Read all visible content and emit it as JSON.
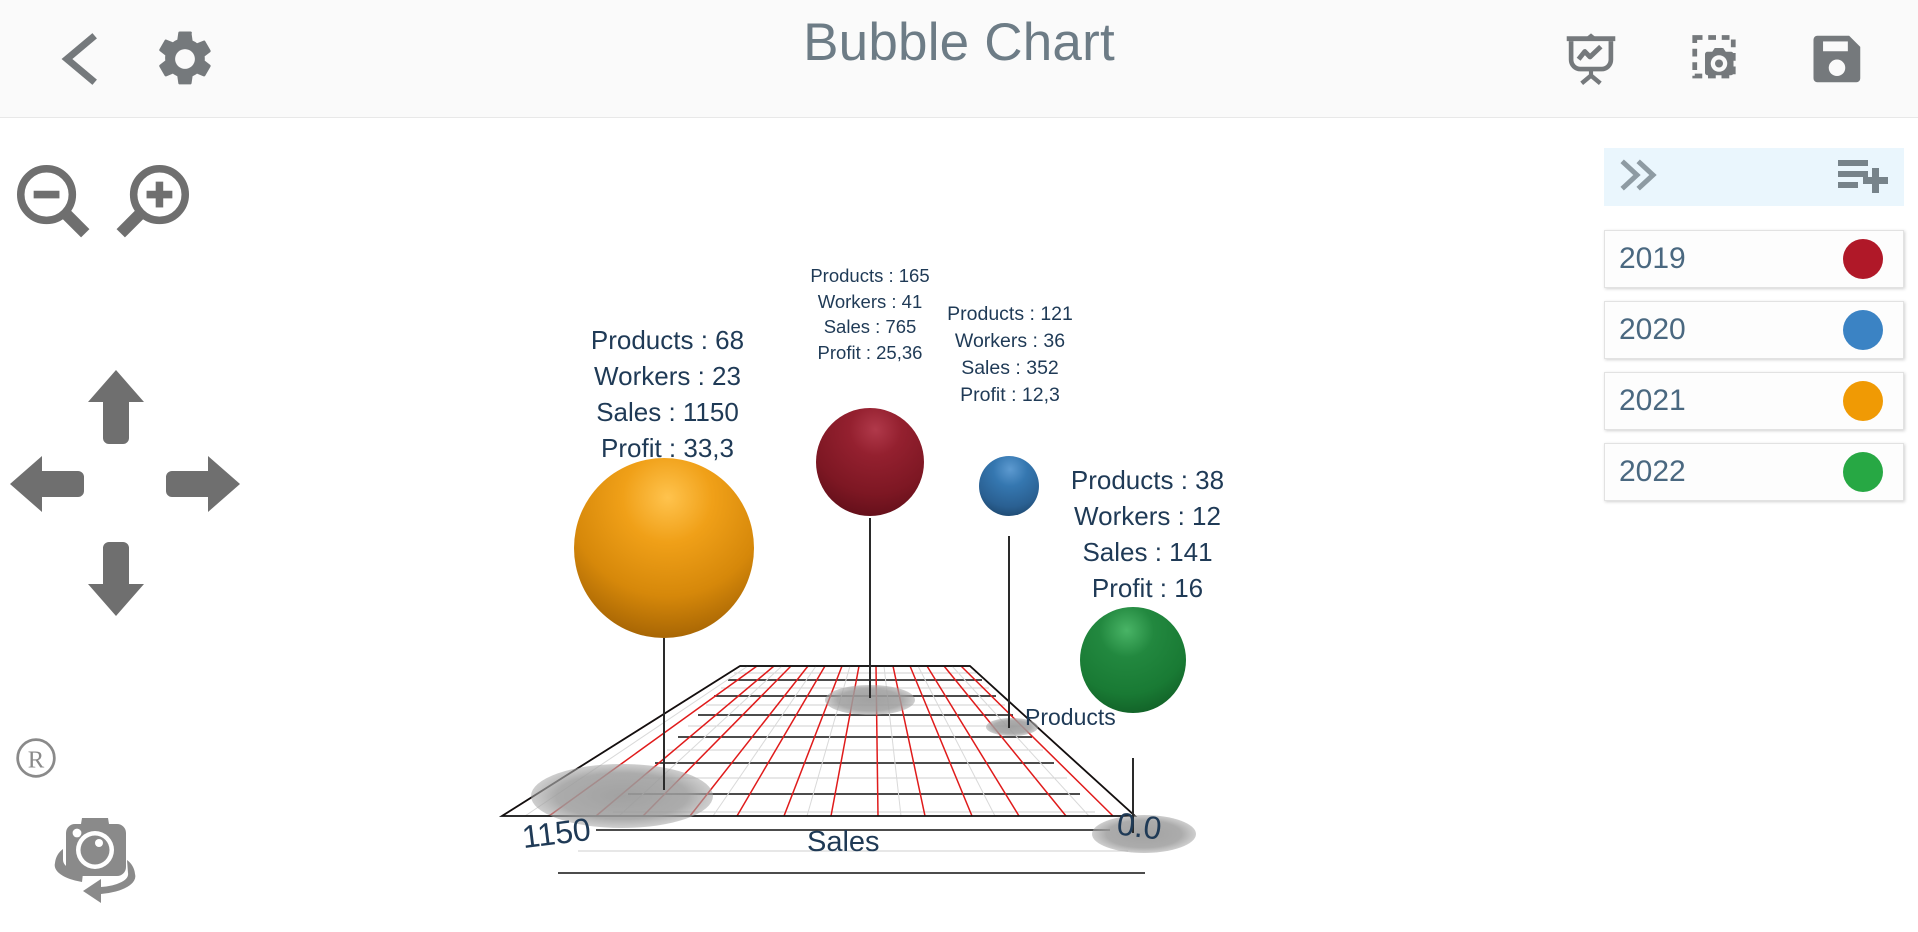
{
  "header": {
    "title": "Bubble Chart",
    "back_icon": "chevron-left-icon",
    "settings_icon": "gear-icon",
    "presentation_icon": "presentation-chart-icon",
    "snapshot_icon": "screenshot-camera-icon",
    "save_icon": "floppy-save-icon"
  },
  "left_rail": {
    "zoom_out_icon": "magnifier-minus-icon",
    "zoom_in_icon": "magnifier-plus-icon",
    "pan_up_icon": "arrow-up-icon",
    "pan_down_icon": "arrow-down-icon",
    "pan_left_icon": "arrow-left-icon",
    "pan_right_icon": "arrow-right-icon",
    "reset_icon": "registered-r-icon",
    "camera_rotate_icon": "camera-rotate-icon"
  },
  "legend": {
    "collapse_icon": "chevron-double-right-icon",
    "add_series_icon": "playlist-add-icon",
    "items": [
      {
        "label": "2019",
        "color": "#b01828"
      },
      {
        "label": "2020",
        "color": "#3b83c4"
      },
      {
        "label": "2021",
        "color": "#f09a04"
      },
      {
        "label": "2022",
        "color": "#27a844"
      }
    ]
  },
  "chart_data": {
    "type": "scatter",
    "title": "Bubble Chart",
    "xlabel": "Sales",
    "zlabel": "Products",
    "x_axis_ticks": [
      "1150",
      "0.0"
    ],
    "xlim": [
      1150,
      0.0
    ],
    "grid": true,
    "legend_position": "right",
    "field_labels": [
      "Products",
      "Workers",
      "Sales",
      "Profit"
    ],
    "points": [
      {
        "series": "2021",
        "color": "#d98907",
        "products": 68,
        "workers": 23,
        "sales": 1150,
        "profit": "33,3",
        "label": "Products : 68\nWorkers : 23\nSales : 1150\nProfit : 33,3",
        "lines": [
          "Products : 68",
          "Workers : 23",
          "Sales : 1150",
          "Profit : 33,3"
        ]
      },
      {
        "series": "2019",
        "color": "#8f1b26",
        "products": 165,
        "workers": 41,
        "sales": 765,
        "profit": "25,36",
        "label": "Products : 165\nWorkers : 41\nSales : 765\nProfit : 25,36",
        "lines": [
          "Products : 165",
          "Workers : 41",
          "Sales : 765",
          "Profit : 25,36"
        ]
      },
      {
        "series": "2020",
        "color": "#2f6ea5",
        "products": 121,
        "workers": 36,
        "sales": 352,
        "profit": "12,3",
        "label": "Products : 121\nWorkers : 36\nSales : 352\nProfit : 12,3",
        "lines": [
          "Products : 121",
          "Workers : 36",
          "Sales : 352",
          "Profit : 12,3"
        ]
      },
      {
        "series": "2022",
        "color": "#178039",
        "products": 38,
        "workers": 12,
        "sales": 141,
        "profit": "16",
        "label": "Products : 38\nWorkers : 12\nSales : 141\nProfit : 16",
        "lines": [
          "Products : 38",
          "Workers : 12",
          "Sales : 141",
          "Profit : 16"
        ]
      }
    ]
  }
}
